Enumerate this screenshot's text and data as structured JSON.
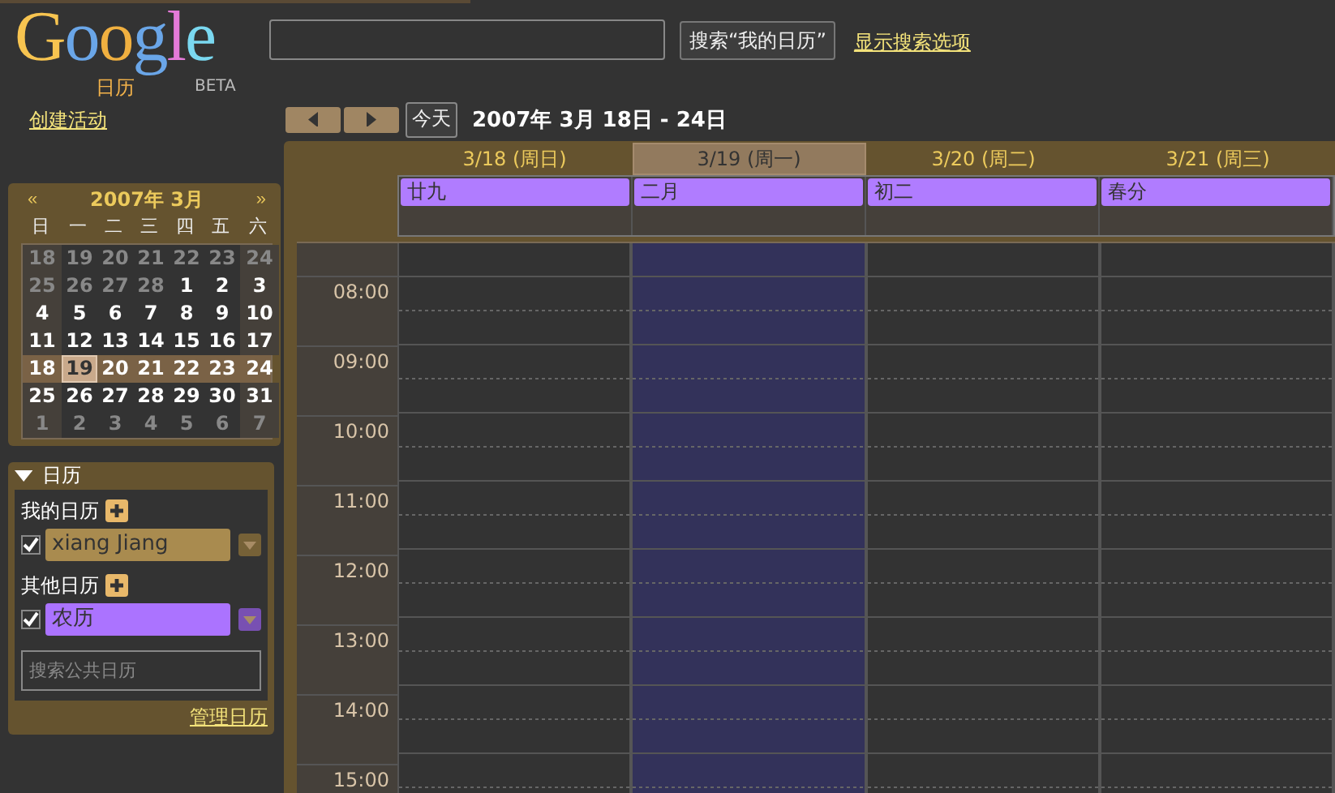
{
  "logo": {
    "wordmark": "Google",
    "subtitle": "日历",
    "badge": "BETA"
  },
  "search": {
    "button": "搜索“我的日历”",
    "link": "显示搜索选项"
  },
  "create_event": "创建活动",
  "nav": {
    "today": "今天",
    "range": "2007年 3月 18日 - 24日"
  },
  "mini_calendar": {
    "prev": "«",
    "title": "2007年 3月",
    "next": "»",
    "weekdays": [
      "日",
      "一",
      "二",
      "三",
      "四",
      "五",
      "六"
    ],
    "weeks": [
      {
        "selected": false,
        "days": [
          {
            "label": "18",
            "other_month": true,
            "today": false
          },
          {
            "label": "19",
            "other_month": true,
            "today": false
          },
          {
            "label": "20",
            "other_month": true,
            "today": false
          },
          {
            "label": "21",
            "other_month": true,
            "today": false
          },
          {
            "label": "22",
            "other_month": true,
            "today": false
          },
          {
            "label": "23",
            "other_month": true,
            "today": false
          },
          {
            "label": "24",
            "other_month": true,
            "today": false
          }
        ]
      },
      {
        "selected": false,
        "days": [
          {
            "label": "25",
            "other_month": true,
            "today": false
          },
          {
            "label": "26",
            "other_month": true,
            "today": false
          },
          {
            "label": "27",
            "other_month": true,
            "today": false
          },
          {
            "label": "28",
            "other_month": true,
            "today": false
          },
          {
            "label": "1",
            "other_month": false,
            "today": false
          },
          {
            "label": "2",
            "other_month": false,
            "today": false
          },
          {
            "label": "3",
            "other_month": false,
            "today": false
          }
        ]
      },
      {
        "selected": false,
        "days": [
          {
            "label": "4",
            "other_month": false,
            "today": false
          },
          {
            "label": "5",
            "other_month": false,
            "today": false
          },
          {
            "label": "6",
            "other_month": false,
            "today": false
          },
          {
            "label": "7",
            "other_month": false,
            "today": false
          },
          {
            "label": "8",
            "other_month": false,
            "today": false
          },
          {
            "label": "9",
            "other_month": false,
            "today": false
          },
          {
            "label": "10",
            "other_month": false,
            "today": false
          }
        ]
      },
      {
        "selected": false,
        "days": [
          {
            "label": "11",
            "other_month": false,
            "today": false
          },
          {
            "label": "12",
            "other_month": false,
            "today": false
          },
          {
            "label": "13",
            "other_month": false,
            "today": false
          },
          {
            "label": "14",
            "other_month": false,
            "today": false
          },
          {
            "label": "15",
            "other_month": false,
            "today": false
          },
          {
            "label": "16",
            "other_month": false,
            "today": false
          },
          {
            "label": "17",
            "other_month": false,
            "today": false
          }
        ]
      },
      {
        "selected": true,
        "days": [
          {
            "label": "18",
            "other_month": false,
            "today": false
          },
          {
            "label": "19",
            "other_month": false,
            "today": true
          },
          {
            "label": "20",
            "other_month": false,
            "today": false
          },
          {
            "label": "21",
            "other_month": false,
            "today": false
          },
          {
            "label": "22",
            "other_month": false,
            "today": false
          },
          {
            "label": "23",
            "other_month": false,
            "today": false
          },
          {
            "label": "24",
            "other_month": false,
            "today": false
          }
        ]
      },
      {
        "selected": false,
        "days": [
          {
            "label": "25",
            "other_month": false,
            "today": false
          },
          {
            "label": "26",
            "other_month": false,
            "today": false
          },
          {
            "label": "27",
            "other_month": false,
            "today": false
          },
          {
            "label": "28",
            "other_month": false,
            "today": false
          },
          {
            "label": "29",
            "other_month": false,
            "today": false
          },
          {
            "label": "30",
            "other_month": false,
            "today": false
          },
          {
            "label": "31",
            "other_month": false,
            "today": false
          }
        ]
      },
      {
        "selected": false,
        "days": [
          {
            "label": "1",
            "other_month": true,
            "today": false
          },
          {
            "label": "2",
            "other_month": true,
            "today": false
          },
          {
            "label": "3",
            "other_month": true,
            "today": false
          },
          {
            "label": "4",
            "other_month": true,
            "today": false
          },
          {
            "label": "5",
            "other_month": true,
            "today": false
          },
          {
            "label": "6",
            "other_month": true,
            "today": false
          },
          {
            "label": "7",
            "other_month": true,
            "today": false
          }
        ]
      }
    ]
  },
  "calendars_panel": {
    "title": "日历",
    "expanded": true,
    "groups": [
      {
        "title": "我的日历",
        "items": [
          {
            "name": "xiang Jiang",
            "checked": true,
            "color": "#a98b4f"
          }
        ]
      },
      {
        "title": "其他日历",
        "items": [
          {
            "name": "农历",
            "checked": true,
            "color": "#ab73ff"
          }
        ]
      }
    ],
    "search_placeholder": "搜索公共日历",
    "manage_link": "管理日历"
  },
  "week_view": {
    "days": [
      {
        "label": "3/18 (周日)",
        "selected": false,
        "all_day": [
          {
            "title": "廿九",
            "color": "#b07cff"
          }
        ]
      },
      {
        "label": "3/19 (周一)",
        "selected": true,
        "all_day": [
          {
            "title": "二月",
            "color": "#b07cff"
          }
        ]
      },
      {
        "label": "3/20 (周二)",
        "selected": false,
        "all_day": [
          {
            "title": "初二",
            "color": "#b07cff"
          }
        ]
      },
      {
        "label": "3/21 (周三)",
        "selected": false,
        "all_day": [
          {
            "title": "春分",
            "color": "#b07cff"
          }
        ]
      }
    ],
    "hours": [
      "08:00",
      "09:00",
      "10:00",
      "11:00",
      "12:00",
      "13:00",
      "14:00",
      "15:00"
    ]
  }
}
